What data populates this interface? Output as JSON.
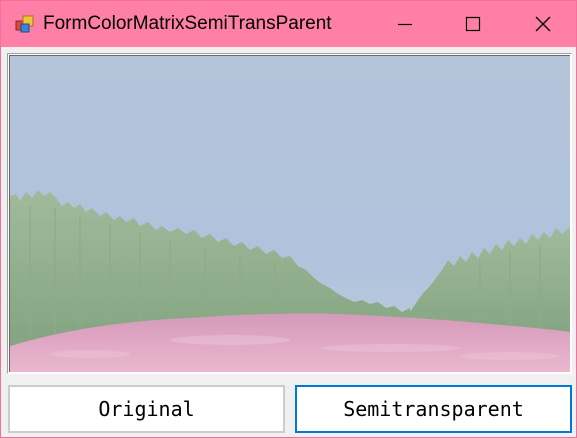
{
  "window": {
    "title": "FormColorMatrixSemiTransParent",
    "app_icon": "winforms-app-icon",
    "titlebar_color": "#ff7fa8",
    "controls": {
      "minimize_icon": "minimize-icon",
      "maximize_icon": "maximize-icon",
      "close_icon": "close-icon"
    }
  },
  "picture": {
    "description_icon": "landscape-image",
    "rendering": "semitransparent"
  },
  "buttons": {
    "original_label": "Original",
    "semitransparent_label": "Semitransparent",
    "focused": "semitransparent",
    "focus_color": "#0078d7"
  }
}
